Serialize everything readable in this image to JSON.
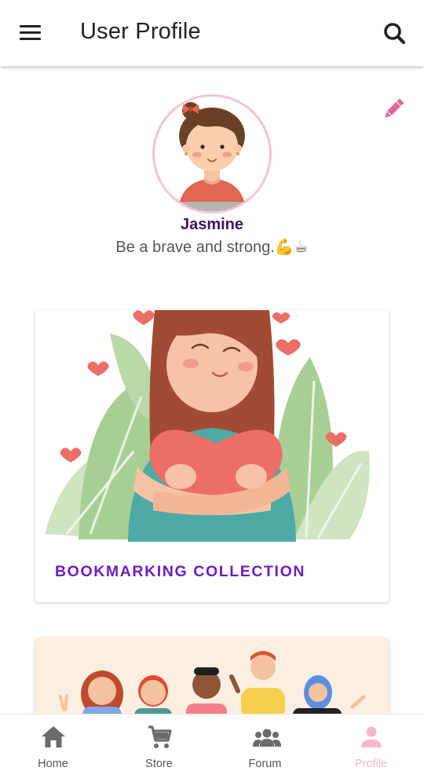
{
  "appbar": {
    "title": "User Profile"
  },
  "profile": {
    "name": "Jasmine",
    "bio": "Be a brave and strong.💪☕"
  },
  "cards": [
    {
      "label": "BOOKMARKING COLLECTION"
    },
    {
      "label": ""
    }
  ],
  "bottom_nav": {
    "items": [
      {
        "label": "Home",
        "icon": "home-icon"
      },
      {
        "label": "Store",
        "icon": "cart-icon"
      },
      {
        "label": "Forum",
        "icon": "group-icon"
      },
      {
        "label": "Profile",
        "icon": "person-icon"
      }
    ],
    "active": "Profile"
  },
  "colors": {
    "accent": "#6a1fc1",
    "name": "#3f1866",
    "active_nav": "#f5b8cf",
    "edit_icon": "#e0679a",
    "avatar_ring": "#f4c4d6"
  }
}
